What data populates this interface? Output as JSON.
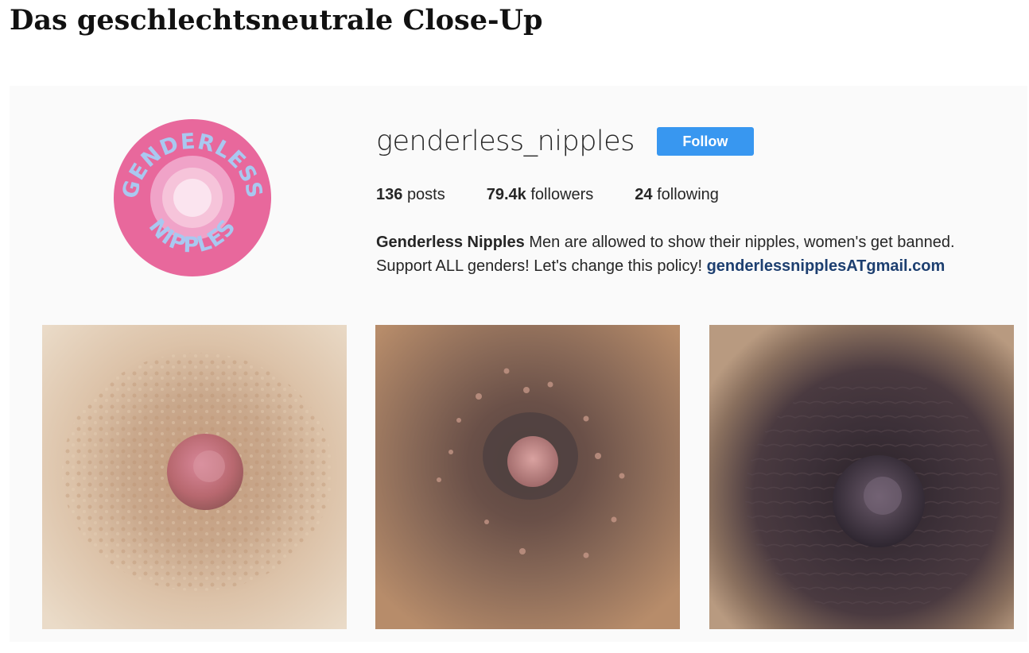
{
  "article": {
    "headline": "Das geschlechtsneutrale Close-Up"
  },
  "profile": {
    "avatar_text_top": "GENDERLESS",
    "avatar_text_bottom": "NIPPLES",
    "username": "genderless_nipples",
    "follow_label": "Follow",
    "stats": {
      "posts_count": "136",
      "posts_label": "posts",
      "followers_count": "79.4k",
      "followers_label": "followers",
      "following_count": "24",
      "following_label": "following"
    },
    "bio": {
      "name": "Genderless Nipples",
      "line1_rest": "Men are allowed to show their nipples, women's get banned.",
      "line2_text": "Support ALL genders! Let's change this policy!",
      "email_link": "genderlessnipplesATgmail.com"
    }
  },
  "colors": {
    "follow_button": "#3897f0",
    "link": "#1d3f70",
    "avatar_pink": "#e8689c",
    "avatar_blue": "#a9c8f0"
  },
  "posts": [
    {
      "tone": "light"
    },
    {
      "tone": "medium"
    },
    {
      "tone": "dark"
    }
  ]
}
